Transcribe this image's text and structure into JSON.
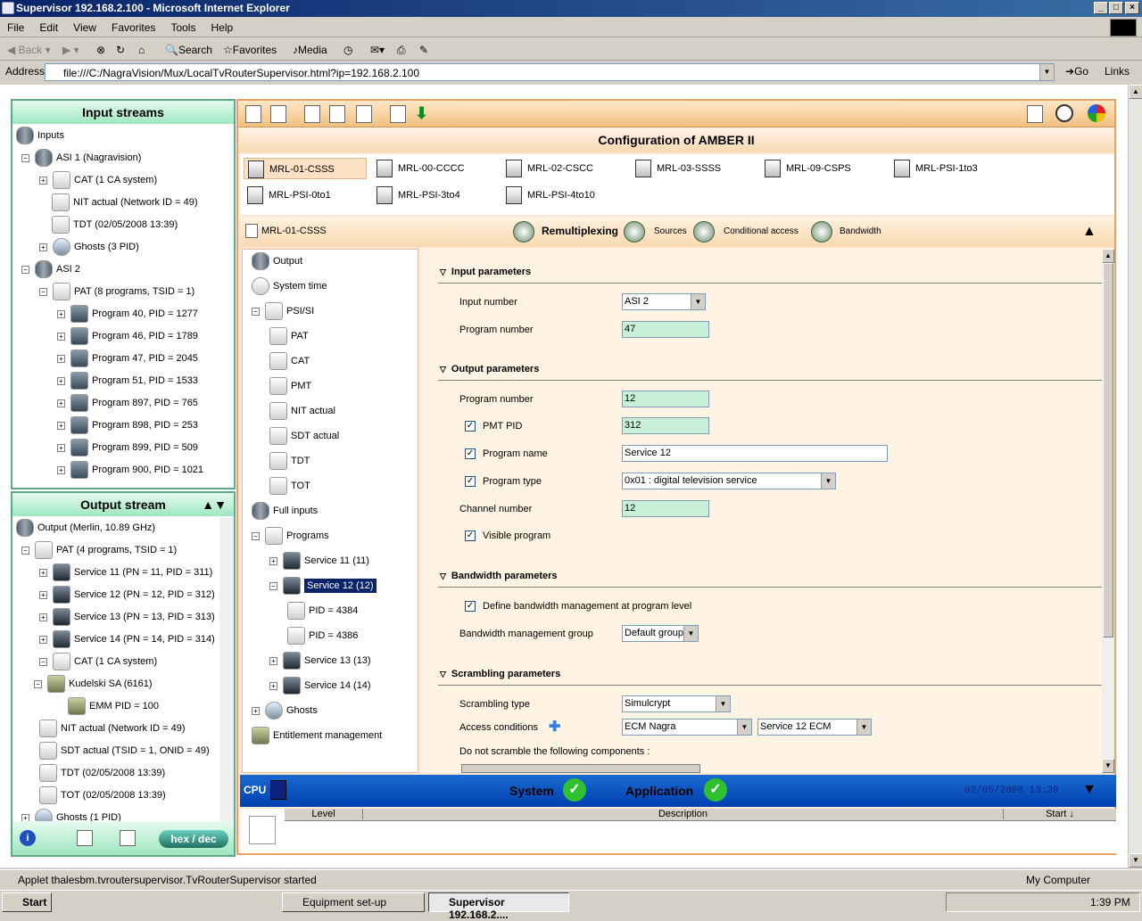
{
  "window": {
    "title": "Supervisor 192.168.2.100 - Microsoft Internet Explorer"
  },
  "menu": [
    "File",
    "Edit",
    "View",
    "Favorites",
    "Tools",
    "Help"
  ],
  "toolbar": {
    "back": "Back",
    "search": "Search",
    "favorites": "Favorites",
    "media": "Media"
  },
  "address": {
    "label": "Address",
    "url": "file:///C:/NagraVision/Mux/LocalTvRouterSupervisor.html?ip=192.168.2.100",
    "go": "Go",
    "links": "Links"
  },
  "input_streams": {
    "title": "Input streams",
    "items": [
      {
        "label": "Inputs",
        "icon": "cable-icon"
      },
      {
        "label": "ASI 1 (Nagravision)",
        "icon": "cable-icon"
      },
      {
        "label": "CAT (1 CA system)",
        "icon": "document-icon"
      },
      {
        "label": "NIT actual (Network ID = 49)",
        "icon": "document-icon"
      },
      {
        "label": "TDT (02/05/2008 13:39)",
        "icon": "document-icon"
      },
      {
        "label": "Ghosts (3 PID)",
        "icon": "ghost-icon"
      },
      {
        "label": "ASI 2",
        "icon": "cable-icon"
      },
      {
        "label": "PAT (8 programs, TSID = 1)",
        "icon": "document-icon"
      },
      {
        "label": "Program 40, PID = 1277",
        "icon": "program-icon"
      },
      {
        "label": "Program 46, PID = 1789",
        "icon": "program-icon"
      },
      {
        "label": "Program 47, PID = 2045",
        "icon": "program-icon"
      },
      {
        "label": "Program 51, PID = 1533",
        "icon": "program-icon"
      },
      {
        "label": "Program 897, PID = 765",
        "icon": "program-icon"
      },
      {
        "label": "Program 898, PID = 253",
        "icon": "program-icon"
      },
      {
        "label": "Program 899, PID = 509",
        "icon": "program-icon"
      },
      {
        "label": "Program 900, PID = 1021",
        "icon": "program-icon"
      }
    ]
  },
  "output_stream": {
    "title": "Output stream",
    "items": [
      {
        "label": "Output (Merlin, 10.89 GHz)",
        "icon": "cable-icon"
      },
      {
        "label": "PAT (4 programs, TSID = 1)",
        "icon": "document-icon"
      },
      {
        "label": "Service 11 (PN = 11, PID = 311)",
        "icon": "service-icon"
      },
      {
        "label": "Service 12 (PN = 12, PID = 312)",
        "icon": "service-icon"
      },
      {
        "label": "Service 13 (PN = 13, PID = 313)",
        "icon": "service-icon"
      },
      {
        "label": "Service 14 (PN = 14, PID = 314)",
        "icon": "service-icon"
      },
      {
        "label": "CAT (1 CA system)",
        "icon": "document-icon"
      },
      {
        "label": "Kudelski SA (6161)",
        "icon": "key-icon"
      },
      {
        "label": "EMM PID = 100",
        "icon": "key-icon"
      },
      {
        "label": "NIT actual (Network ID = 49)",
        "icon": "document-icon"
      },
      {
        "label": "SDT actual (TSID = 1, ONID = 49)",
        "icon": "document-icon"
      },
      {
        "label": "TDT (02/05/2008 13:39)",
        "icon": "document-icon"
      },
      {
        "label": "TOT (02/05/2008 13:39)",
        "icon": "document-icon"
      },
      {
        "label": "Ghosts (1 PID)",
        "icon": "ghost-icon"
      }
    ],
    "hexdec": "hex / dec"
  },
  "config": {
    "title": "Configuration of AMBER II",
    "mrls": [
      "MRL-01-CSSS",
      "MRL-00-CCCC",
      "MRL-02-CSCC",
      "MRL-03-SSSS",
      "MRL-09-CSPS",
      "MRL-PSI-1to3",
      "MRL-PSI-0to1",
      "MRL-PSI-3to4",
      "MRL-PSI-4to10"
    ],
    "current": "MRL-01-CSSS",
    "tabs": {
      "remux": "Remultiplexing",
      "sources": "Sources",
      "ca": "Conditional access",
      "bandwidth": "Bandwidth"
    }
  },
  "nav": [
    {
      "label": "Output"
    },
    {
      "label": "System time"
    },
    {
      "label": "PSI/SI"
    },
    {
      "label": "PAT"
    },
    {
      "label": "CAT"
    },
    {
      "label": "PMT"
    },
    {
      "label": "NIT actual"
    },
    {
      "label": "SDT actual"
    },
    {
      "label": "TDT"
    },
    {
      "label": "TOT"
    },
    {
      "label": "Full inputs"
    },
    {
      "label": "Programs"
    },
    {
      "label": "Service 11 (11)"
    },
    {
      "label": "Service 12 (12)"
    },
    {
      "label": "PID = 4384"
    },
    {
      "label": "PID = 4386"
    },
    {
      "label": "Service 13 (13)"
    },
    {
      "label": "Service 14 (14)"
    },
    {
      "label": "Ghosts"
    },
    {
      "label": "Entitlement management"
    }
  ],
  "form": {
    "input_params": "Input parameters",
    "input_number_label": "Input number",
    "input_number": "ASI 2",
    "program_number_label": "Program number",
    "input_program_number": "47",
    "output_params": "Output parameters",
    "output_program_number": "12",
    "pmt_pid_label": "PMT PID",
    "pmt_pid": "312",
    "program_name_label": "Program name",
    "program_name": "Service 12",
    "program_type_label": "Program type",
    "program_type": "0x01 : digital television service",
    "channel_number_label": "Channel number",
    "channel_number": "12",
    "visible_program_label": "Visible program",
    "bandwidth_params": "Bandwidth parameters",
    "define_bw_label": "Define bandwidth management at program level",
    "bw_group_label": "Bandwidth management group",
    "bw_group": "Default group",
    "scrambling_params": "Scrambling parameters",
    "scrambling_type_label": "Scrambling type",
    "scrambling_type": "Simulcrypt",
    "access_conditions_label": "Access conditions",
    "ecm": "ECM Nagra",
    "service_ecm": "Service 12 ECM",
    "no_scramble_label": "Do not scramble the following components :"
  },
  "status": {
    "cpu": "CPU",
    "system": "System",
    "application": "Application",
    "datetime": "02/05/2008 13:39"
  },
  "log": {
    "col_level": "Level",
    "col_description": "Description",
    "col_start": "Start"
  },
  "statusbar": {
    "text": "Applet thalesbm.tvroutersupervisor.TvRouterSupervisor started",
    "zone": "My Computer"
  },
  "taskbar": {
    "start": "Start",
    "task1": "Equipment set-up",
    "task2": "Supervisor 192.168.2....",
    "clock": "1:39 PM"
  }
}
